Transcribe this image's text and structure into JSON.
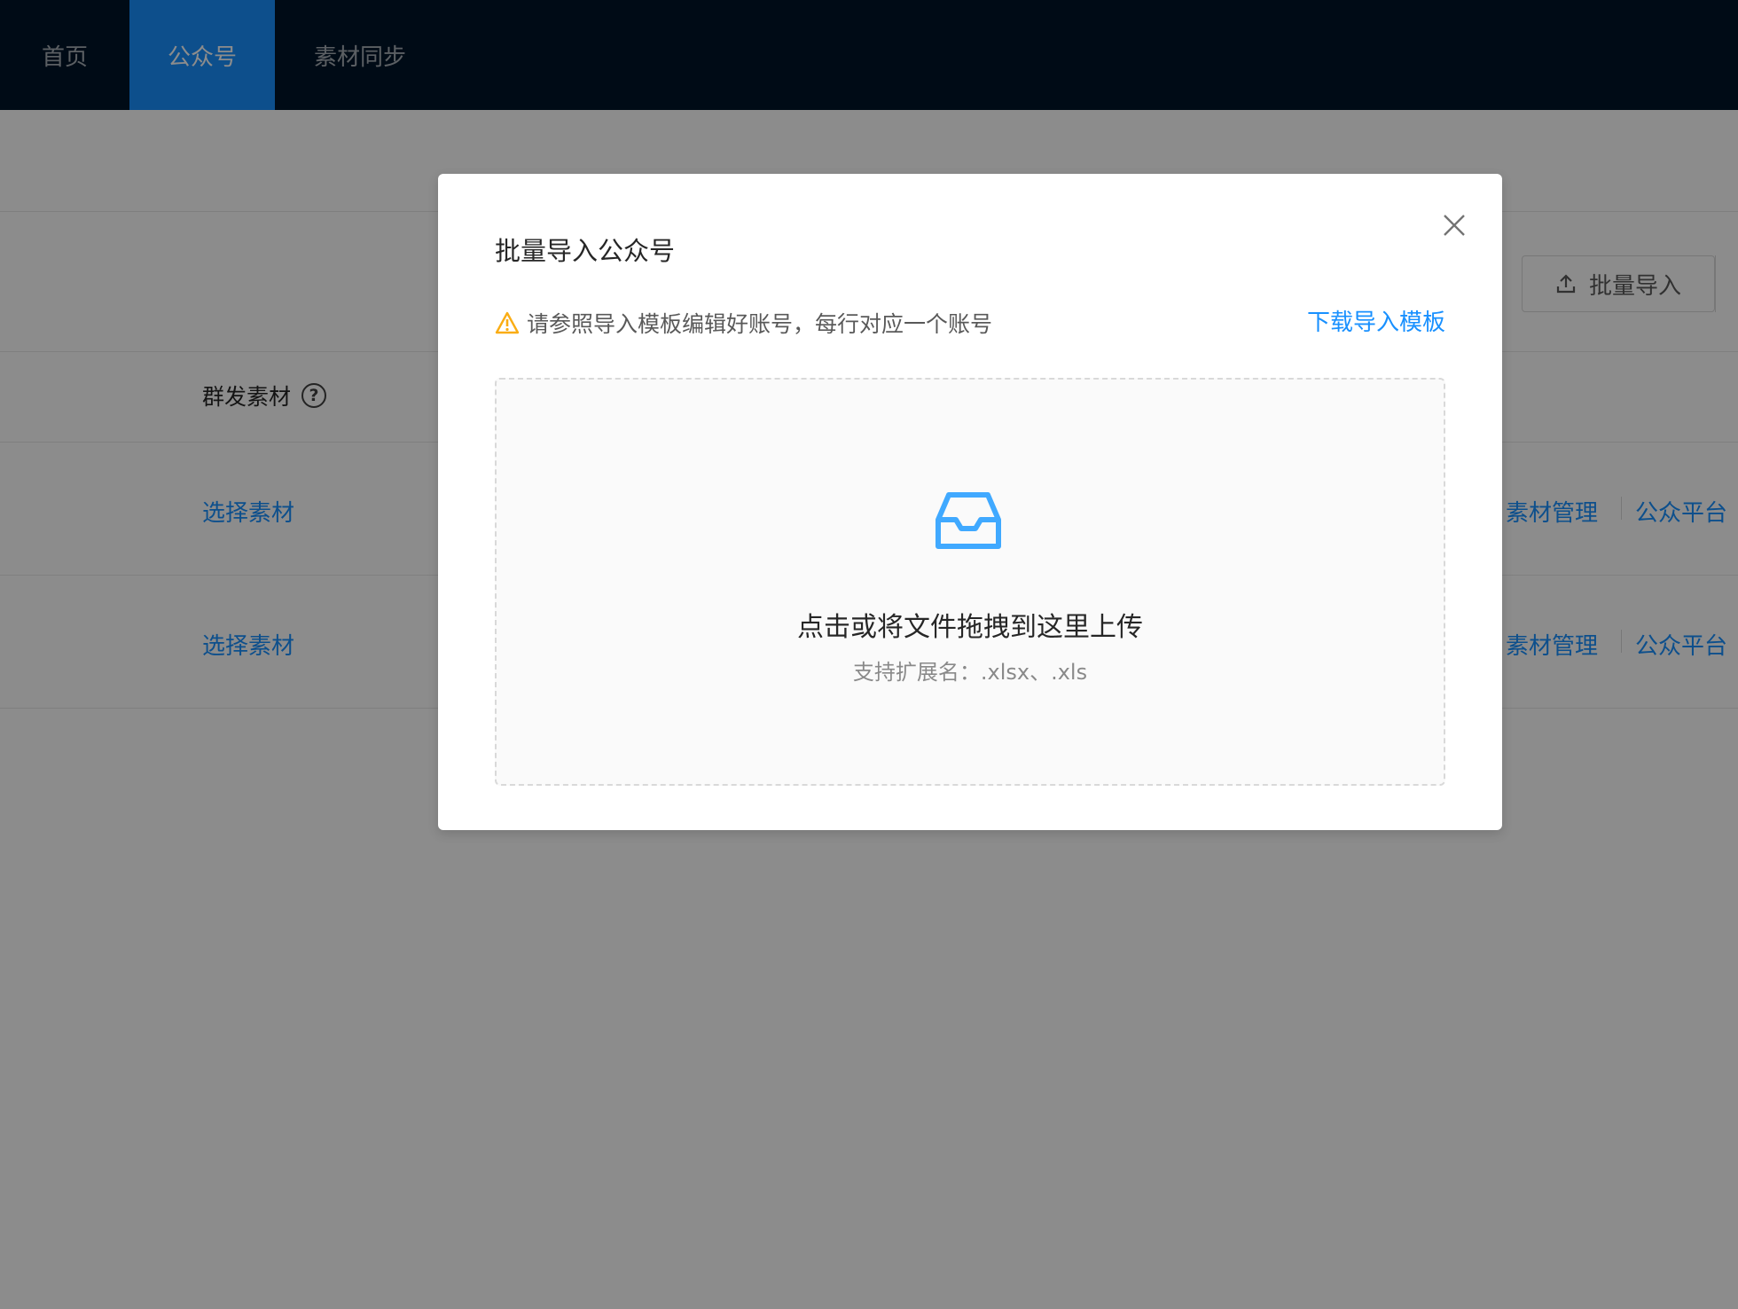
{
  "nav": {
    "items": [
      {
        "label": "首页"
      },
      {
        "label": "公众号"
      },
      {
        "label": "素材同步"
      }
    ]
  },
  "toolbar": {
    "batch_import_label": "批量导入"
  },
  "table": {
    "header_material": "群发素材",
    "help_glyph": "?",
    "rows": [
      {
        "select_label": "选择素材",
        "action_manage": "素材管理",
        "action_platform": "公众平台"
      },
      {
        "select_label": "选择素材",
        "action_manage": "素材管理",
        "action_platform": "公众平台"
      }
    ]
  },
  "modal": {
    "title": "批量导入公众号",
    "warning": "请参照导入模板编辑好账号，每行对应一个账号",
    "download_link": "下载导入模板",
    "upload_text": "点击或将文件拖拽到这里上传",
    "upload_hint": "支持扩展名：.xlsx、.xls"
  },
  "colors": {
    "nav_bg": "#001529",
    "primary": "#1890ff",
    "warning": "#faad14"
  }
}
